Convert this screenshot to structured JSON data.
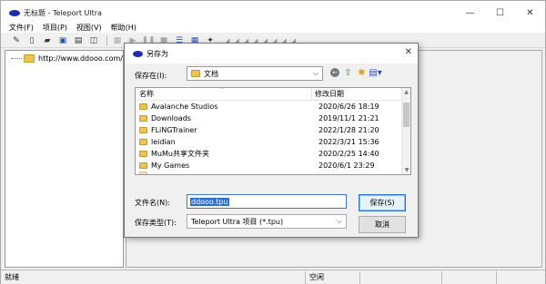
{
  "window": {
    "title": "无标题 - Teleport Ultra",
    "controls": {
      "minimize": "—",
      "maximize": "☐",
      "close": "✕"
    }
  },
  "menu": {
    "items": [
      "文件(F)",
      "项目(P)",
      "视图(V)",
      "帮助(H)"
    ]
  },
  "toolbar": {
    "icons": [
      "edit-icon",
      "new-icon",
      "open-icon",
      "save-icon",
      "properties-icon",
      "folder-open-icon",
      "offline-icon",
      "play-icon",
      "pause-icon",
      "stop-icon",
      "list-view-icon",
      "grid-view-icon",
      "scheduler-icon"
    ]
  },
  "tree": {
    "root_label": "http://www.ddooo.com/"
  },
  "status": {
    "left": "就绪",
    "middle": "空闲"
  },
  "dialog": {
    "title": "另存为",
    "close": "✕",
    "save_in_label": "保存在(I):",
    "save_in_value": "文档",
    "list": {
      "col_name": "名称",
      "col_date": "修改日期",
      "rows": [
        {
          "name": "Avalanche Studios",
          "date": "2020/6/26 18:19"
        },
        {
          "name": "Downloads",
          "date": "2019/11/1 21:21"
        },
        {
          "name": "FLiNGTrainer",
          "date": "2022/1/28 21:20"
        },
        {
          "name": "leidian",
          "date": "2022/3/21 15:36"
        },
        {
          "name": "MuMu共享文件夹",
          "date": "2020/2/25 14:40"
        },
        {
          "name": "My Games",
          "date": "2020/6/1 23:29"
        }
      ]
    },
    "filename_label": "文件名(N):",
    "filename_value": "ddooo.tpu",
    "filetype_label": "保存类型(T):",
    "filetype_value": "Teleport Ultra 项目 (*.tpu)",
    "save_button": "保存(S)",
    "cancel_button": "取消"
  },
  "colors": {
    "accent": "#2f6fd0",
    "app_icon": "#1c2bb0",
    "folder": "#e8c45a"
  }
}
